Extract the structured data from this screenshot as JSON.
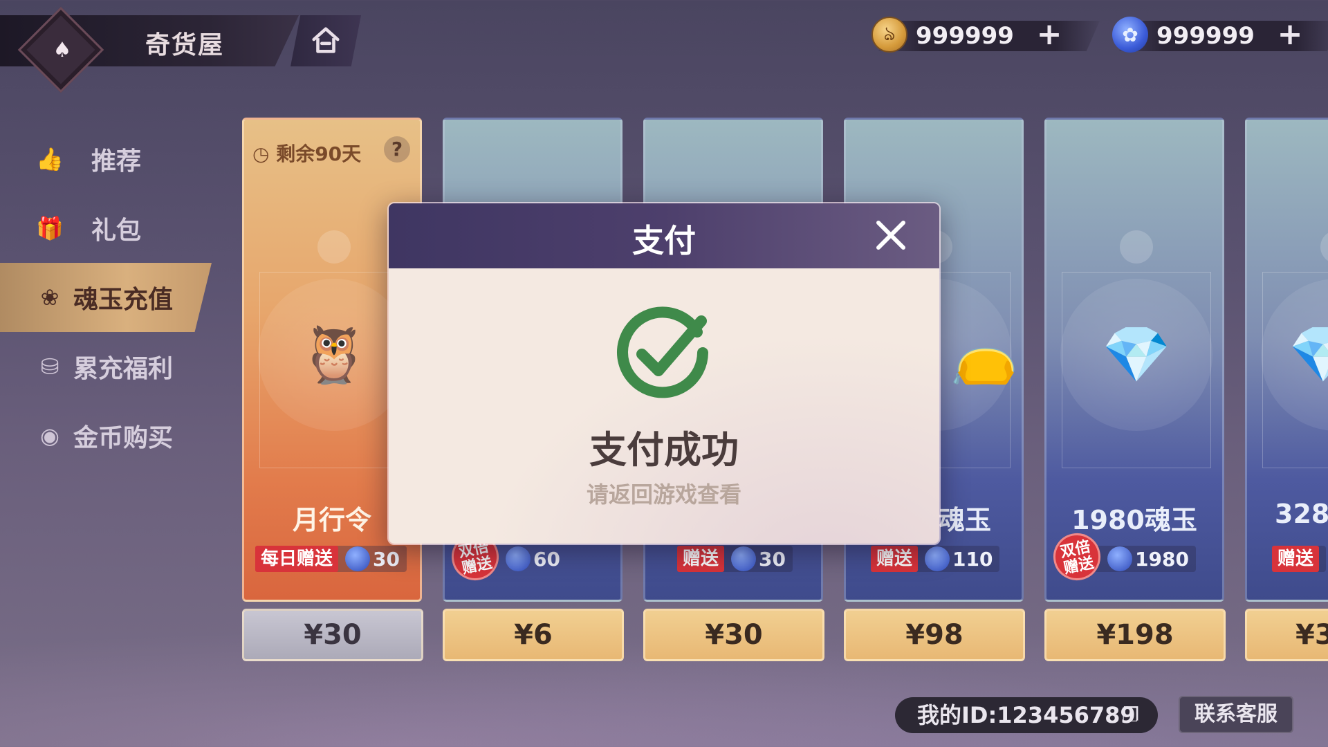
{
  "header": {
    "title": "奇货屋",
    "logo_icon": "spade-shop-icon",
    "home_icon": "home-icon"
  },
  "currencies": [
    {
      "name": "gold-coin",
      "icon": "coin-icon",
      "value": "999999",
      "plus": "+"
    },
    {
      "name": "soul-jade",
      "icon": "jade-icon",
      "value": "999999",
      "plus": "+"
    }
  ],
  "sidebar": {
    "items": [
      {
        "label": "推荐",
        "icon": "thumbs-up-icon",
        "active": false
      },
      {
        "label": "礼包",
        "icon": "gift-icon",
        "active": false
      },
      {
        "label": "魂玉充值",
        "icon": "jade-rabbit-icon",
        "active": true
      },
      {
        "label": "累充福利",
        "icon": "coin-stack-icon",
        "active": false
      },
      {
        "label": "金币购买",
        "icon": "coin-icon",
        "active": false
      }
    ]
  },
  "cards": [
    {
      "timer": "剩余90天",
      "qmark": "?",
      "name": "月行令",
      "bonus_tag": "每日赠送",
      "bonus_value": "30",
      "price": "¥30",
      "double": false
    },
    {
      "name": "",
      "bonus_tag": "双倍\n赠送",
      "bonus_value": "60",
      "price": "¥6",
      "double": true
    },
    {
      "name": "",
      "bonus_tag": "赠送",
      "bonus_value": "30",
      "price": "¥30",
      "double": false
    },
    {
      "name": "魂玉",
      "bonus_tag": "赠送",
      "bonus_value": "110",
      "price": "¥98",
      "double": false
    },
    {
      "name": "1980魂玉",
      "bonus_tag": "双倍\n赠送",
      "bonus_value": "1980",
      "price": "¥198",
      "double": true
    },
    {
      "name": "328",
      "bonus_tag": "赠送",
      "bonus_value": "",
      "price": "¥3",
      "double": false
    }
  ],
  "footer": {
    "my_id": "我的ID:123456789",
    "contact": "联系客服"
  },
  "dialog": {
    "title": "支付",
    "status": "支付成功",
    "hint": "请返回游戏查看",
    "check_color": "#3f8a4a"
  },
  "colors": {
    "price_gold": "#e8b874",
    "tag_red": "#d8333a",
    "dialog_header": "#3f3662"
  }
}
